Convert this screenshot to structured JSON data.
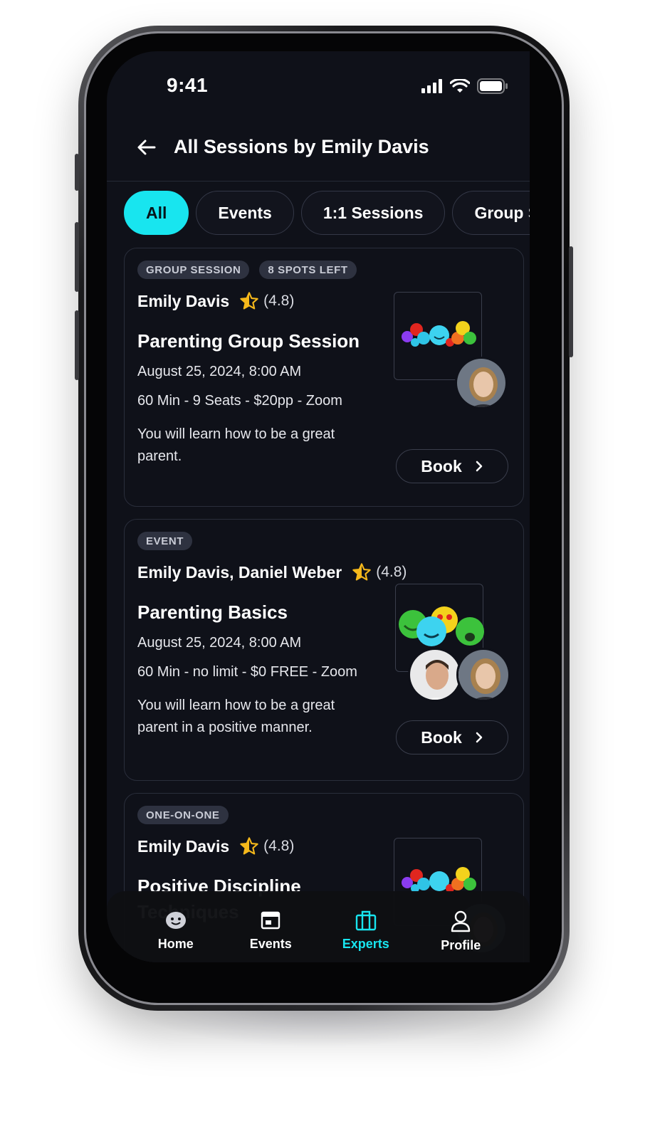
{
  "status_bar": {
    "time": "9:41"
  },
  "header": {
    "title": "All Sessions by Emily Davis"
  },
  "filters": [
    "All",
    "Events",
    "1:1 Sessions",
    "Group Sessions"
  ],
  "cards": [
    {
      "badges": [
        "GROUP SESSION",
        "8 SPOTS LEFT"
      ],
      "host": "Emily Davis",
      "rating": "(4.8)",
      "title": "Parenting Group Session",
      "date": "August 25, 2024, 8:00 AM",
      "meta": "60 Min - 9 Seats - $20pp - Zoom",
      "description": "You will learn how to be a great parent.",
      "button": "Book"
    },
    {
      "badges": [
        "EVENT"
      ],
      "host": "Emily Davis, Daniel Weber",
      "rating": "(4.8)",
      "title": "Parenting Basics",
      "date": "August 25, 2024, 8:00 AM",
      "meta": "60 Min - no limit - $0 FREE - Zoom",
      "description": "You will learn how to be a great parent in a positive manner.",
      "button": "Book"
    },
    {
      "badges": [
        "ONE-ON-ONE"
      ],
      "host": "Emily Davis",
      "rating": "(4.8)",
      "title": "Positive Discipline Techniques"
    }
  ],
  "nav": [
    {
      "label": "Home",
      "icon": "home-icon"
    },
    {
      "label": "Events",
      "icon": "calendar-icon"
    },
    {
      "label": "Experts",
      "icon": "briefcase-icon"
    },
    {
      "label": "Profile",
      "icon": "profile-icon"
    }
  ],
  "colors": {
    "accent": "#18e5ef",
    "background": "#0f1119",
    "star": "#f5b81b"
  }
}
